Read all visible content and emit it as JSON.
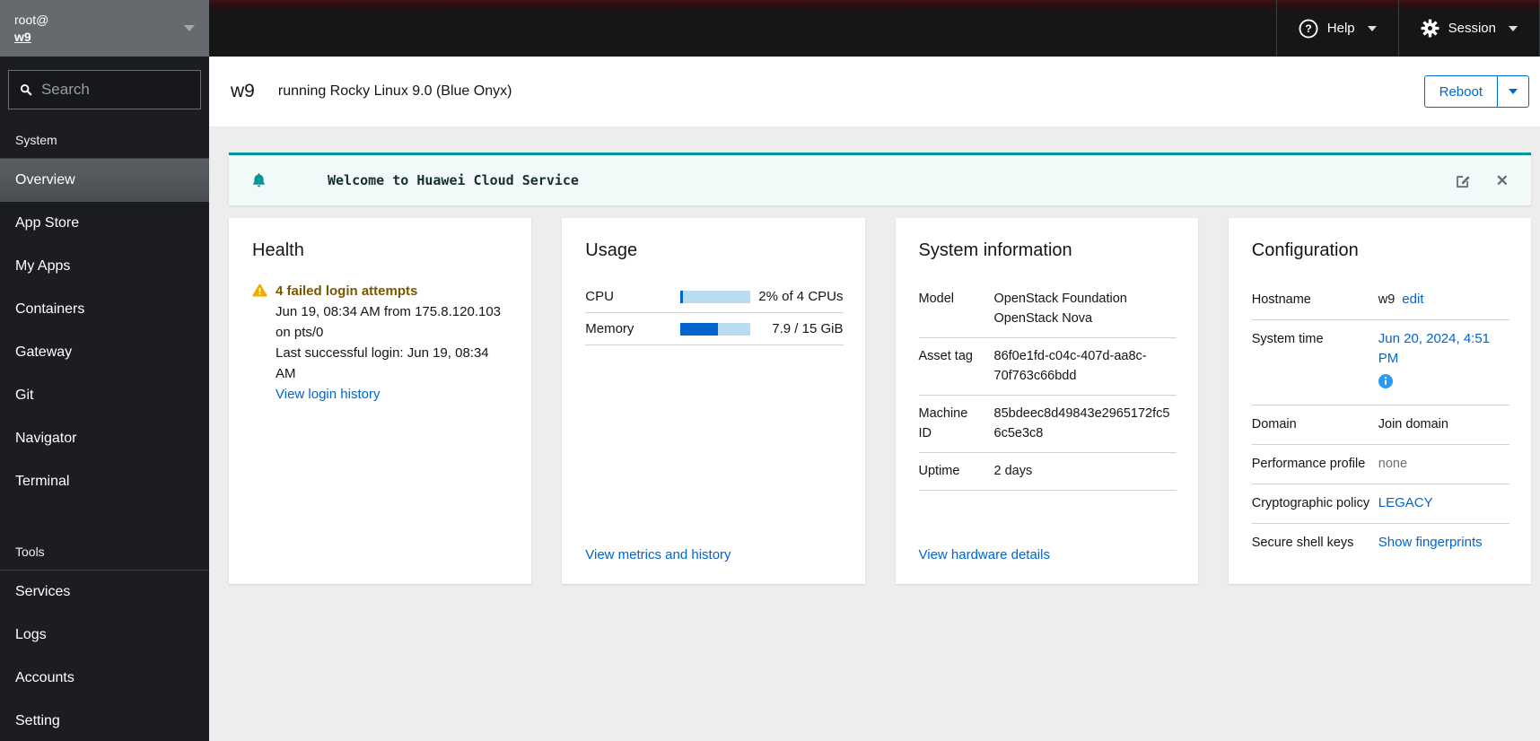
{
  "masthead": {
    "help_label": "Help",
    "session_label": "Session"
  },
  "sidebar": {
    "user": "root@",
    "host": "w9",
    "search_placeholder": "Search",
    "sections": [
      {
        "label": "System",
        "items": [
          {
            "label": "Overview",
            "selected": true
          },
          {
            "label": "App Store"
          },
          {
            "label": "My Apps"
          },
          {
            "label": "Containers"
          },
          {
            "label": "Gateway"
          },
          {
            "label": "Git"
          },
          {
            "label": "Navigator"
          },
          {
            "label": "Terminal"
          }
        ]
      },
      {
        "label": "Tools",
        "items": [
          {
            "label": "Services"
          },
          {
            "label": "Logs"
          },
          {
            "label": "Accounts"
          },
          {
            "label": "Setting"
          }
        ]
      }
    ]
  },
  "header": {
    "hostname": "w9",
    "subtitle": "running Rocky Linux 9.0 (Blue Onyx)",
    "reboot_label": "Reboot"
  },
  "alert": {
    "title": "Welcome to Huawei Cloud Service"
  },
  "health": {
    "title": "Health",
    "warning_title": "4 failed login attempts",
    "details": [
      "Jun 19, 08:34 AM from 175.8.120.103 on pts/0",
      "Last successful login: Jun 19, 08:34 AM"
    ],
    "link": "View login history"
  },
  "usage": {
    "title": "Usage",
    "rows": [
      {
        "label": "CPU",
        "percent": 3,
        "value": "2% of 4 CPUs"
      },
      {
        "label": "Memory",
        "percent": 53,
        "value": "7.9 / 15 GiB"
      }
    ],
    "link": "View metrics and history"
  },
  "system_info": {
    "title": "System information",
    "rows": [
      {
        "label": "Model",
        "value": "OpenStack Foundation OpenStack Nova"
      },
      {
        "label": "Asset tag",
        "value": "86f0e1fd-c04c-407d-aa8c-70f763c66bdd"
      },
      {
        "label": "Machine ID",
        "value": "85bdeec8d49843e2965172fc56c5e3c8"
      },
      {
        "label": "Uptime",
        "value": "2 days"
      }
    ],
    "link": "View hardware details"
  },
  "config": {
    "title": "Configuration",
    "rows": [
      {
        "label": "Hostname",
        "parts": [
          {
            "text": "w9",
            "style": "text"
          },
          {
            "text": "edit",
            "style": "link"
          }
        ]
      },
      {
        "label": "System time",
        "parts": [
          {
            "text": "Jun 20, 2024, 4:51 PM",
            "style": "link"
          }
        ],
        "info_icon": true
      },
      {
        "label": "Domain",
        "parts": [
          {
            "text": "Join domain",
            "style": "text"
          }
        ]
      },
      {
        "label": "Performance profile",
        "parts": [
          {
            "text": "none",
            "style": "muted"
          }
        ]
      },
      {
        "label": "Cryptographic policy",
        "parts": [
          {
            "text": "LEGACY",
            "style": "link"
          }
        ]
      },
      {
        "label": "Secure shell keys",
        "parts": [
          {
            "text": "Show fingerprints",
            "style": "link"
          }
        ]
      }
    ]
  },
  "colors": {
    "accent_teal": "#009596",
    "link_blue": "#0066cc",
    "warning_gold": "#f0ab00",
    "masthead_red": "#44111a"
  }
}
